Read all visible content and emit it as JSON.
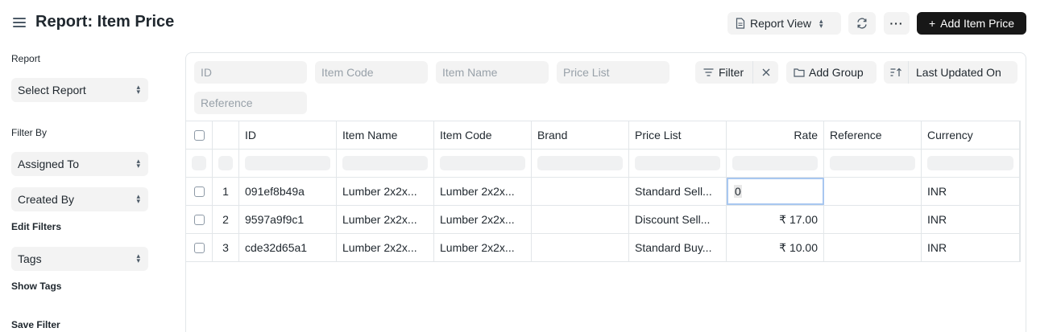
{
  "header": {
    "title": "Report: Item Price",
    "view_label": "Report View",
    "more_label": "···",
    "add_label": "Add Item Price"
  },
  "sidebar": {
    "report_label": "Report",
    "report_select": "Select Report",
    "filter_by_label": "Filter By",
    "assigned_to": "Assigned To",
    "created_by": "Created By",
    "edit_filters": "Edit Filters",
    "tags": "Tags",
    "show_tags": "Show Tags",
    "save_filter": "Save Filter"
  },
  "filters": {
    "id_placeholder": "ID",
    "item_code_placeholder": "Item Code",
    "item_name_placeholder": "Item Name",
    "price_list_placeholder": "Price List",
    "reference_placeholder": "Reference",
    "filter_label": "Filter",
    "add_group_label": "Add Group",
    "sort_label": "Last Updated On"
  },
  "table": {
    "columns": [
      "ID",
      "Item Name",
      "Item Code",
      "Brand",
      "Price List",
      "Rate",
      "Reference",
      "Currency"
    ],
    "rows": [
      {
        "n": "1",
        "id": "091ef8b49a",
        "item_name": "Lumber 2x2x...",
        "item_code": "Lumber 2x2x...",
        "brand": "",
        "price_list": "Standard Sell...",
        "rate": "0",
        "reference": "",
        "currency": "INR"
      },
      {
        "n": "2",
        "id": "9597a9f9c1",
        "item_name": "Lumber 2x2x...",
        "item_code": "Lumber 2x2x...",
        "brand": "",
        "price_list": "Discount Sell...",
        "rate": "₹ 17.00",
        "reference": "",
        "currency": "INR"
      },
      {
        "n": "3",
        "id": "cde32d65a1",
        "item_name": "Lumber 2x2x...",
        "item_code": "Lumber 2x2x...",
        "brand": "",
        "price_list": "Standard Buy...",
        "rate": "₹ 10.00",
        "reference": "",
        "currency": "INR"
      }
    ]
  },
  "icons": {
    "menu": "hamburger-icon",
    "view": "document-icon",
    "refresh": "refresh-icon",
    "add": "plus-icon",
    "filter": "filter-icon",
    "clear": "close-icon",
    "group": "folder-icon",
    "sort": "sort-icon"
  },
  "colors": {
    "primary_button": "#171717",
    "border": "#e2e6e9",
    "input_bg": "#f3f3f3",
    "edit_highlight": "#a8c7f0"
  }
}
